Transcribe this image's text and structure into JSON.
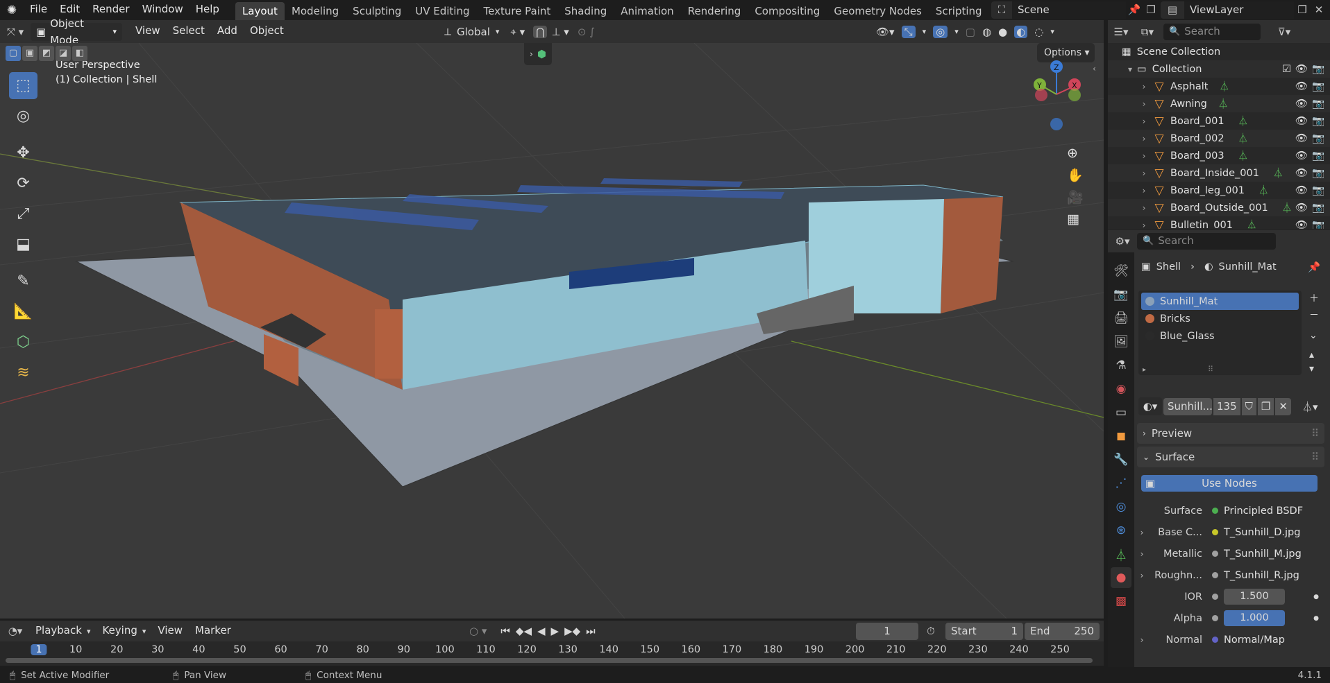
{
  "topbar": {
    "menus": [
      "File",
      "Edit",
      "Render",
      "Window",
      "Help"
    ],
    "workspaces": [
      "Layout",
      "Modeling",
      "Sculpting",
      "UV Editing",
      "Texture Paint",
      "Shading",
      "Animation",
      "Rendering",
      "Compositing",
      "Geometry Nodes",
      "Scripting"
    ],
    "active_workspace": "Layout",
    "scene": "Scene",
    "view_layer": "ViewLayer"
  },
  "viewport_header": {
    "mode": "Object Mode",
    "menus": [
      "View",
      "Select",
      "Add",
      "Object"
    ],
    "orientation": "Global",
    "options": "Options"
  },
  "viewport": {
    "perspective": "User Perspective",
    "context": "(1) Collection | Shell",
    "axis_labels": {
      "x": "X",
      "y": "Y",
      "z": "Z"
    }
  },
  "outliner": {
    "search_placeholder": "Search",
    "root": "Scene Collection",
    "collection": "Collection",
    "items": [
      "Asphalt",
      "Awning",
      "Board_001",
      "Board_002",
      "Board_003",
      "Board_Inside_001",
      "Board_leg_001",
      "Board_Outside_001",
      "Bulletin_001"
    ]
  },
  "properties": {
    "search_placeholder": "Search",
    "breadcrumb_object": "Shell",
    "breadcrumb_material": "Sunhill_Mat",
    "material_slots": [
      "Sunhill_Mat",
      "Bricks",
      "Blue_Glass"
    ],
    "active_slot": "Sunhill_Mat",
    "material_name": "Sunhill...",
    "user_count": "135",
    "preview_label": "Preview",
    "surface_label": "Surface",
    "use_nodes": "Use Nodes",
    "rows": [
      {
        "label": "Surface",
        "value": "Principled BSDF",
        "socket": "#4caf50",
        "expand": false,
        "kind": "link"
      },
      {
        "label": "Base C...",
        "value": "T_Sunhill_D.jpg",
        "socket": "#c7c729",
        "expand": true,
        "kind": "link"
      },
      {
        "label": "Metallic",
        "value": "T_Sunhill_M.jpg",
        "socket": "#a1a1a1",
        "expand": true,
        "kind": "link"
      },
      {
        "label": "Roughn...",
        "value": "T_Sunhill_R.jpg",
        "socket": "#a1a1a1",
        "expand": true,
        "kind": "link"
      },
      {
        "label": "IOR",
        "value": "1.500",
        "socket": "#a1a1a1",
        "expand": false,
        "kind": "number"
      },
      {
        "label": "Alpha",
        "value": "1.000",
        "socket": "#a1a1a1",
        "expand": false,
        "kind": "slider"
      },
      {
        "label": "Normal",
        "value": "Normal/Map",
        "socket": "#6363c7",
        "expand": true,
        "kind": "link"
      }
    ]
  },
  "timeline": {
    "menus": [
      "Playback",
      "Keying",
      "View",
      "Marker"
    ],
    "current_frame": "1",
    "start_label": "Start",
    "start": "1",
    "end_label": "End",
    "end": "250",
    "ticks": [
      "1",
      "10",
      "20",
      "30",
      "40",
      "50",
      "60",
      "70",
      "80",
      "90",
      "100",
      "110",
      "120",
      "130",
      "140",
      "150",
      "160",
      "170",
      "180",
      "190",
      "200",
      "210",
      "220",
      "230",
      "240",
      "250"
    ]
  },
  "statusbar": {
    "left": "Set Active Modifier",
    "middle": "Pan View",
    "right": "Context Menu",
    "version": "4.1.1"
  },
  "colors": {
    "accent": "#4772b3",
    "viewport_bg": "#3a3a3a",
    "panel_bg": "#303030",
    "object_icon": "#f19a3e"
  }
}
